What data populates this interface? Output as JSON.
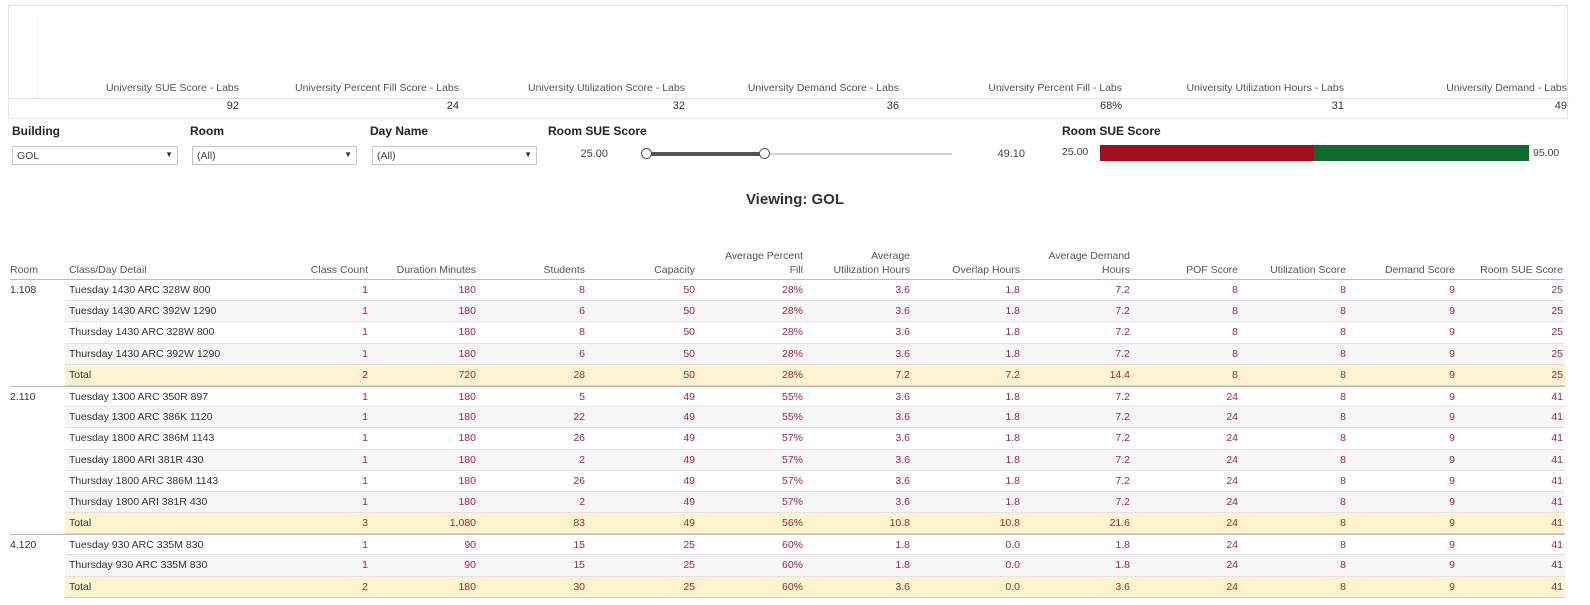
{
  "kpi": {
    "headers": [
      "University SUE Score - Labs",
      "University Percent Fill Score - Labs",
      "University Utilization Score - Labs",
      "University Demand Score - Labs",
      "University Percent Fill - Labs",
      "University Utilization Hours - Labs",
      "University Demand - Labs"
    ],
    "values": [
      "92",
      "24",
      "32",
      "36",
      "68%",
      "31",
      "49"
    ]
  },
  "filters": {
    "building_label": "Building",
    "building_value": "GOL",
    "room_label": "Room",
    "room_value": "(All)",
    "day_label": "Day Name",
    "day_value": "(All)",
    "sue_slider_label": "Room SUE Score",
    "sue_slider_min": "25.00",
    "sue_slider_max": "49.10",
    "sue_legend_label": "Room SUE Score",
    "sue_legend_min": "25.00",
    "sue_legend_max": "95.00",
    "legend_colors": {
      "low": "#a1101f",
      "high": "#0f6b2b"
    }
  },
  "viewing": "Viewing: GOL",
  "table": {
    "headers": {
      "room": "Room",
      "detail": "Class/Day Detail",
      "class_count": "Class Count",
      "duration": "Duration Minutes",
      "students": "Students",
      "capacity": "Capacity",
      "avg_fill_1": "Average Percent",
      "avg_fill_2": "Fill",
      "avg_util_1": "Average",
      "avg_util_2": "Utilization Hours",
      "overlap": "Overlap Hours",
      "avg_demand_1": "Average Demand",
      "avg_demand_2": "Hours",
      "pof": "POF Score",
      "util_score": "Utilization Score",
      "demand_score": "Demand Score",
      "sue_score": "Room SUE Score"
    },
    "rows": [
      {
        "room": "1.108",
        "detail": "Tuesday 1430 ARC  328W 800",
        "v": [
          "1",
          "180",
          "8",
          "50",
          "28%",
          "3.6",
          "1.8",
          "7.2",
          "8",
          "8",
          "9",
          "25"
        ]
      },
      {
        "room": "",
        "detail": "Tuesday 1430 ARC  392W 1290",
        "v": [
          "1",
          "180",
          "6",
          "50",
          "28%",
          "3.6",
          "1.8",
          "7.2",
          "8",
          "8",
          "9",
          "25"
        ]
      },
      {
        "room": "",
        "detail": "Thursday 1430 ARC  328W 800",
        "v": [
          "1",
          "180",
          "8",
          "50",
          "28%",
          "3.6",
          "1.8",
          "7.2",
          "8",
          "8",
          "9",
          "25"
        ]
      },
      {
        "room": "",
        "detail": "Thursday 1430 ARC  392W 1290",
        "v": [
          "1",
          "180",
          "6",
          "50",
          "28%",
          "3.6",
          "1.8",
          "7.2",
          "8",
          "8",
          "9",
          "25"
        ]
      },
      {
        "room": "",
        "detail": "Total",
        "total": true,
        "v": [
          "2",
          "720",
          "28",
          "50",
          "28%",
          "7.2",
          "7.2",
          "14.4",
          "8",
          "8",
          "9",
          "25"
        ]
      },
      {
        "room": "2.110",
        "detail": "Tuesday 1300 ARC  350R 897",
        "v": [
          "1",
          "180",
          "5",
          "49",
          "55%",
          "3.6",
          "1.8",
          "7.2",
          "24",
          "8",
          "9",
          "41"
        ]
      },
      {
        "room": "",
        "detail": "Tuesday 1300 ARC  386K 1120",
        "v": [
          "1",
          "180",
          "22",
          "49",
          "55%",
          "3.6",
          "1.8",
          "7.2",
          "24",
          "8",
          "9",
          "41"
        ]
      },
      {
        "room": "",
        "detail": "Tuesday 1800 ARC  386M 1143",
        "v": [
          "1",
          "180",
          "26",
          "49",
          "57%",
          "3.6",
          "1.8",
          "7.2",
          "24",
          "8",
          "9",
          "41"
        ]
      },
      {
        "room": "",
        "detail": "Tuesday 1800 ARI  381R 430",
        "v": [
          "1",
          "180",
          "2",
          "49",
          "57%",
          "3.6",
          "1.8",
          "7.2",
          "24",
          "8",
          "9",
          "41"
        ]
      },
      {
        "room": "",
        "detail": "Thursday 1800 ARC  386M 1143",
        "v": [
          "1",
          "180",
          "26",
          "49",
          "57%",
          "3.6",
          "1.8",
          "7.2",
          "24",
          "8",
          "9",
          "41"
        ]
      },
      {
        "room": "",
        "detail": "Thursday 1800 ARI  381R 430",
        "v": [
          "1",
          "180",
          "2",
          "49",
          "57%",
          "3.6",
          "1.8",
          "7.2",
          "24",
          "8",
          "9",
          "41"
        ]
      },
      {
        "room": "",
        "detail": "Total",
        "total": true,
        "v": [
          "3",
          "1,080",
          "83",
          "49",
          "56%",
          "10.8",
          "10.8",
          "21.6",
          "24",
          "8",
          "9",
          "41"
        ]
      },
      {
        "room": "4.120",
        "detail": "Tuesday 930 ARC  335M 830",
        "v": [
          "1",
          "90",
          "15",
          "25",
          "60%",
          "1.8",
          "0.0",
          "1.8",
          "24",
          "8",
          "9",
          "41"
        ]
      },
      {
        "room": "",
        "detail": "Thursday 930 ARC  335M 830",
        "v": [
          "1",
          "90",
          "15",
          "25",
          "60%",
          "1.8",
          "0.0",
          "1.8",
          "24",
          "8",
          "9",
          "41"
        ]
      },
      {
        "room": "",
        "detail": "Total",
        "total": true,
        "v": [
          "2",
          "180",
          "30",
          "25",
          "60%",
          "3.6",
          "0.0",
          "3.6",
          "24",
          "8",
          "9",
          "41"
        ]
      }
    ]
  }
}
